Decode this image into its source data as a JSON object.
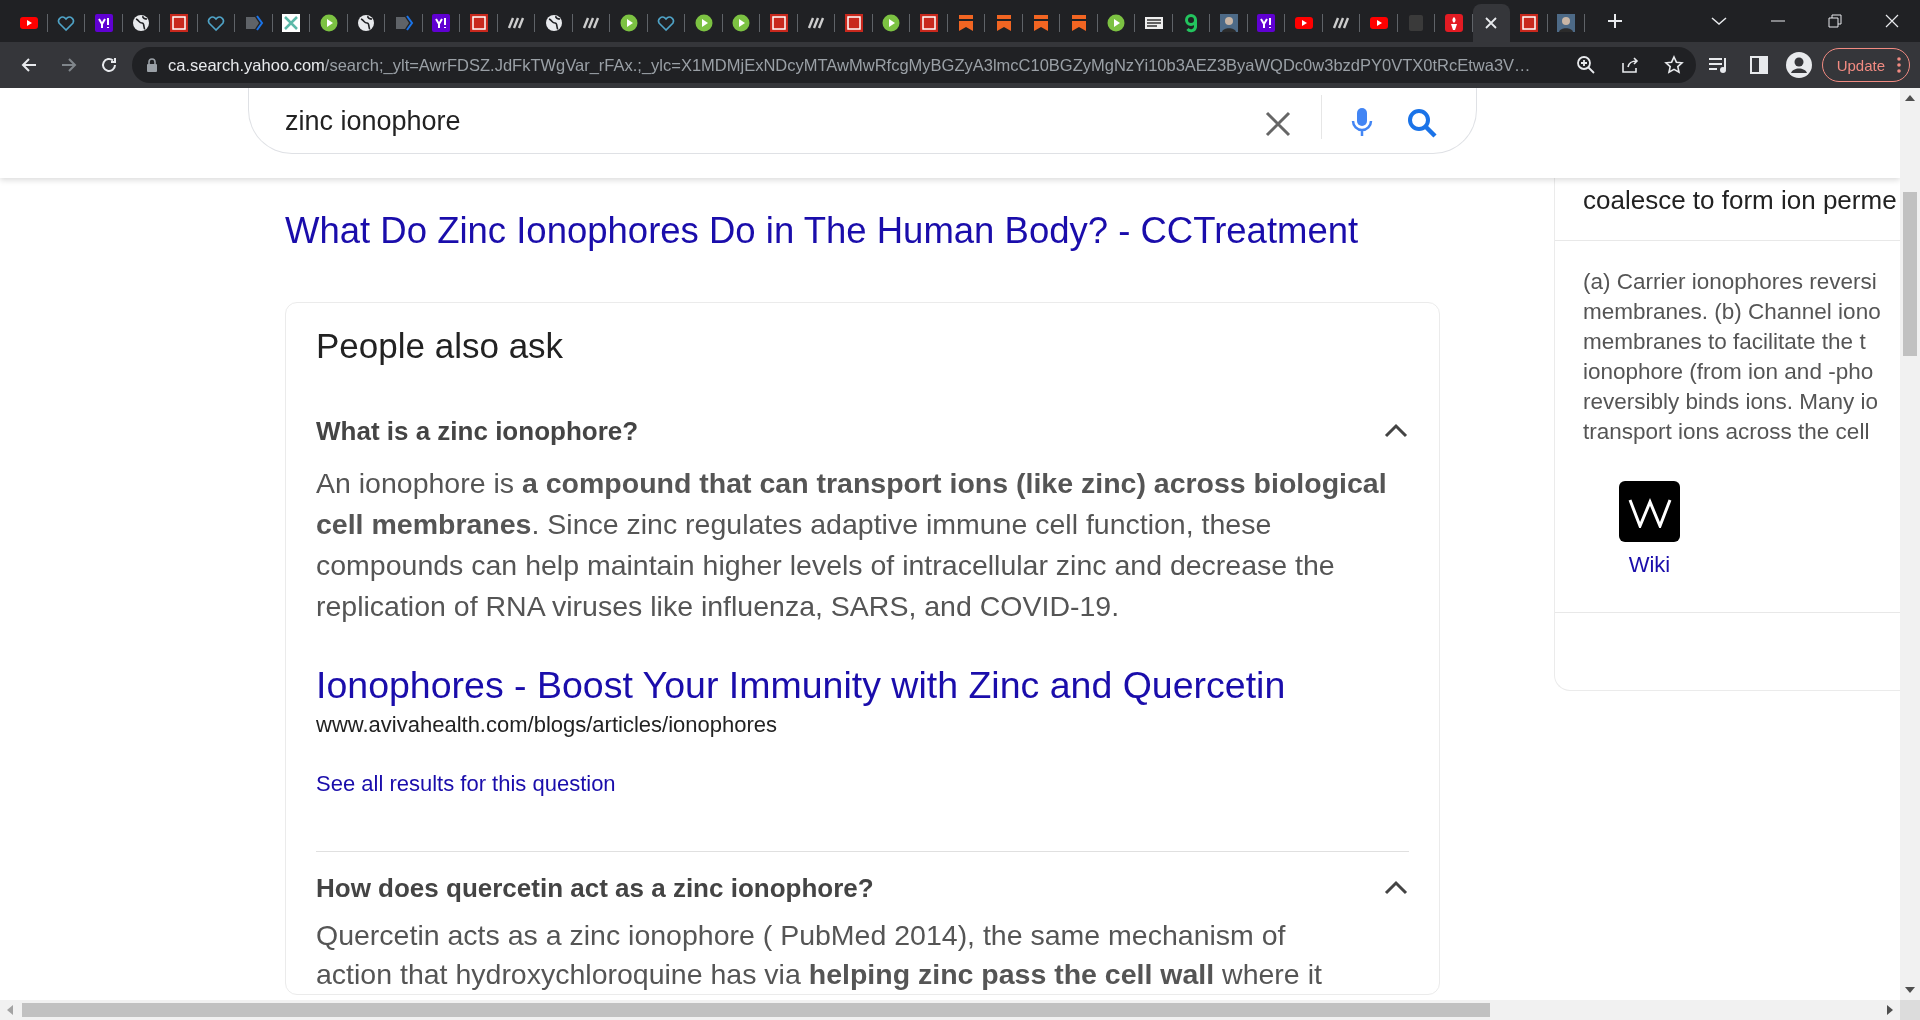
{
  "tabs": [
    {
      "kind": "youtube",
      "selected": false
    },
    {
      "kind": "heart",
      "selected": false
    },
    {
      "kind": "yahoo",
      "selected": false
    },
    {
      "kind": "globe",
      "selected": false
    },
    {
      "kind": "bi",
      "selected": false
    },
    {
      "kind": "heart",
      "selected": false
    },
    {
      "kind": "arrow",
      "selected": false
    },
    {
      "kind": "puzzle",
      "selected": false
    },
    {
      "kind": "play",
      "selected": false
    },
    {
      "kind": "globe",
      "selected": false
    },
    {
      "kind": "arrow",
      "selected": false
    },
    {
      "kind": "yahoo",
      "selected": false
    },
    {
      "kind": "bi",
      "selected": false
    },
    {
      "kind": "dr",
      "selected": false
    },
    {
      "kind": "globe",
      "selected": false
    },
    {
      "kind": "dr",
      "selected": false
    },
    {
      "kind": "play",
      "selected": false
    },
    {
      "kind": "heart",
      "selected": false
    },
    {
      "kind": "play",
      "selected": false
    },
    {
      "kind": "play",
      "selected": false
    },
    {
      "kind": "bi",
      "selected": false
    },
    {
      "kind": "dr",
      "selected": false
    },
    {
      "kind": "bi",
      "selected": false
    },
    {
      "kind": "play",
      "selected": false
    },
    {
      "kind": "bi",
      "selected": false
    },
    {
      "kind": "bookmark",
      "selected": false
    },
    {
      "kind": "bookmark",
      "selected": false
    },
    {
      "kind": "bookmark",
      "selected": false
    },
    {
      "kind": "bookmark",
      "selected": false
    },
    {
      "kind": "play",
      "selected": false
    },
    {
      "kind": "news",
      "selected": false
    },
    {
      "kind": "leaf",
      "selected": false
    },
    {
      "kind": "person",
      "selected": false
    },
    {
      "kind": "yahoo",
      "selected": false
    },
    {
      "kind": "youtube",
      "selected": false
    },
    {
      "kind": "dr",
      "selected": false
    },
    {
      "kind": "youtube",
      "selected": false
    },
    {
      "kind": "dark",
      "selected": false
    },
    {
      "kind": "torch",
      "selected": false
    },
    {
      "kind": "blank",
      "selected": true
    },
    {
      "kind": "bi",
      "selected": false
    },
    {
      "kind": "person",
      "selected": false
    }
  ],
  "address_bar": {
    "host": "ca.search.yahoo.com",
    "path": "/search;_ylt=AwrFDSZ.JdFkTWgVar_rFAx.;_ylc=X1MDMjExNDcyMTAwMwRfcgMyBGZyA3lmcC10BGZyMgNzYi10b3AEZ3ByaWQDc0w3bzdPY0VTX0tRcEtwa3V…"
  },
  "update_button": "Update",
  "search": {
    "value": "zinc ionophore"
  },
  "result_title": "What Do Zinc Ionophores Do in The Human Body? - CCTreatment",
  "people_also_ask": {
    "heading": "People also ask",
    "questions": [
      {
        "question": "What is a zinc ionophore?",
        "expanded": true,
        "answer": "An ionophore is **a compound that can transport ions (like zinc) across biological cell membranes**. Since zinc regulates adaptive immune cell function, these compounds can help maintain higher levels of intracellular zinc and decrease the replication of RNA viruses like influenza, SARS, and COVID-19.",
        "link": "Ionophores - Boost Your Immunity with Zinc and Quercetin",
        "url": "www.avivahealth.com/blogs/articles/ionophores",
        "see_all": "See all results for this question"
      },
      {
        "question": "How does quercetin act as a zinc ionophore?",
        "expanded": true,
        "answer_lines": [
          "Quercetin acts as a zinc ionophore ( PubMed 2014), the same mechanism of",
          "action that hydroxychloroquine has via **helping zinc pass the cell wall** where it"
        ]
      }
    ]
  },
  "side_panel": {
    "top_line": "coalesce to form ion perme",
    "lines": [
      "(a) Carrier ionophores reversi",
      "membranes. (b) Channel iono",
      "membranes to facilitate the t",
      "ionophore (from ion and -pho",
      "reversibly binds ions. Many io",
      "transport ions across the cell"
    ],
    "source": "Wiki"
  }
}
